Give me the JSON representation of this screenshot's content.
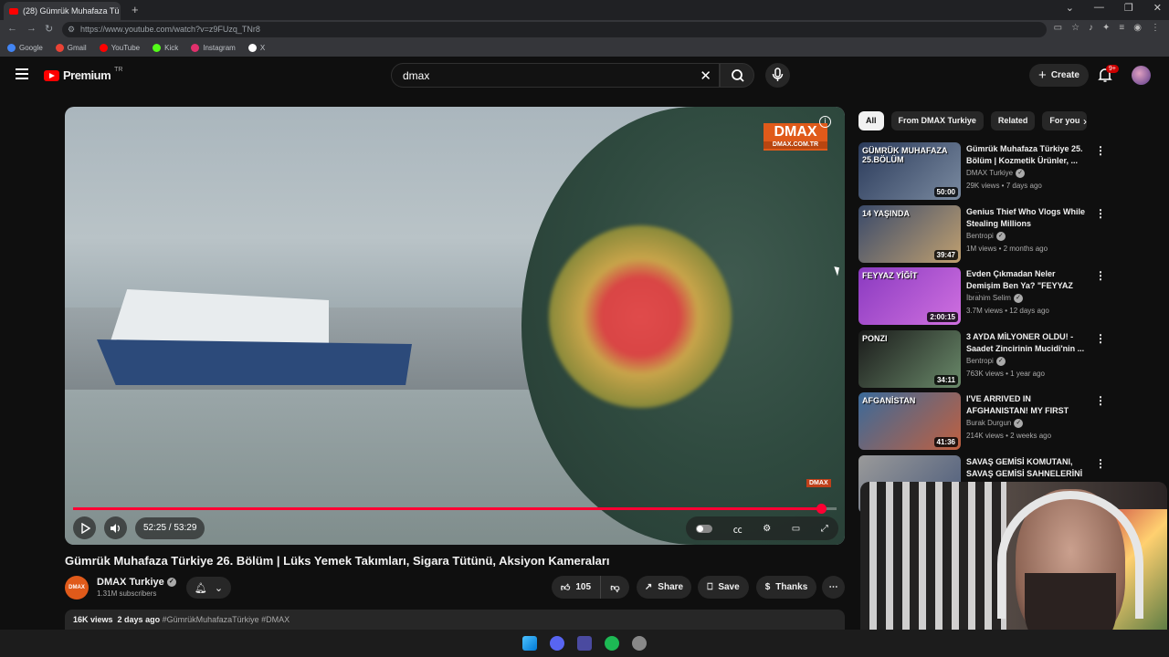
{
  "browser": {
    "tab_title": "(28) Gümrük Muhafaza Tü",
    "url": "https://www.youtube.com/watch?v=z9FUzq_TNr8",
    "bookmarks": [
      {
        "label": "Google",
        "color": "#4285f4"
      },
      {
        "label": "Gmail",
        "color": "#ea4335"
      },
      {
        "label": "YouTube",
        "color": "#ff0000"
      },
      {
        "label": "Kick",
        "color": "#53fc18"
      },
      {
        "label": "Instagram",
        "color": "#e1306c"
      },
      {
        "label": "X",
        "color": "#ffffff"
      }
    ]
  },
  "header": {
    "logo_text": "Premium",
    "region": "TR",
    "search_value": "dmax",
    "create_label": "Create",
    "notif_badge": "9+"
  },
  "player": {
    "time": "52:25 / 53:29",
    "progress_fraction": 0.98,
    "watermark_main": "DMAX",
    "watermark_sub": "DMAX.COM.TR",
    "corner_logo": "DMAX"
  },
  "video": {
    "title": "Gümrük Muhafaza Türkiye 26. Bölüm | Lüks Yemek Takımları, Sigara Tütünü, Aksiyon Kameraları",
    "channel": "DMAX Turkiye",
    "subscribers": "1.31M subscribers",
    "channel_avatar_text": "DMAX",
    "likes": "105",
    "share_label": "Share",
    "save_label": "Save",
    "thanks_label": "Thanks",
    "views": "16K views",
    "date": "2 days ago",
    "tags": "#GümrükMuhafazaTürkiye #DMAX"
  },
  "sidebar": {
    "chips": [
      "All",
      "From DMAX Turkiye",
      "Related",
      "For you"
    ],
    "recommendations": [
      {
        "title": "Gümrük Muhafaza Türkiye 25. Bölüm | Kozmetik Ürünler, ...",
        "channel": "DMAX Turkiye",
        "meta": "29K views • 7 days ago",
        "duration": "50:00",
        "overlay": "GÜMRÜK MUHAFAZA 25.BÖLÜM",
        "bg": "linear-gradient(135deg,#2a3a5a,#7a8aa0)"
      },
      {
        "title": "Genius Thief Who Vlogs While Stealing Millions",
        "channel": "Bentropi",
        "meta": "1M views • 2 months ago",
        "duration": "39:47",
        "overlay": "14 YAŞINDA",
        "bg": "linear-gradient(135deg,#3a4a6a,#c0a070)"
      },
      {
        "title": "Evden Çıkmadan Neler Demişim Ben Ya? \"FEYYAZ YİĞİT\" - ...",
        "channel": "İbrahim Selim",
        "meta": "3.7M views • 12 days ago",
        "duration": "2:00:15",
        "overlay": "FEYYAZ YİĞİT",
        "bg": "linear-gradient(135deg,#8a3ac0,#d070e0)"
      },
      {
        "title": "3 AYDA MİLYONER OLDU! - Saadet Zincirinin Mucidi'nin ...",
        "channel": "Bentropi",
        "meta": "763K views • 1 year ago",
        "duration": "34:11",
        "overlay": "PONZI",
        "bg": "linear-gradient(135deg,#1a1a1a,#6a8a6a)"
      },
      {
        "title": "I'VE ARRIVED IN AFGHANISTAN! MY FIRST DA...",
        "channel": "Burak Durgun",
        "meta": "214K views • 2 weeks ago",
        "duration": "41:36",
        "overlay": "AFGANİSTAN",
        "bg": "linear-gradient(135deg,#3a6a9a,#c06040)"
      },
      {
        "title": "SAVAŞ GEMİSİ KOMUTANI, SAVAŞ GEMİSİ SAHNELERİNİ ...",
        "channel": "",
        "meta": "",
        "duration": "",
        "overlay": "",
        "bg": "linear-gradient(135deg,#9a9a9a,#4a5a7a)"
      }
    ]
  }
}
